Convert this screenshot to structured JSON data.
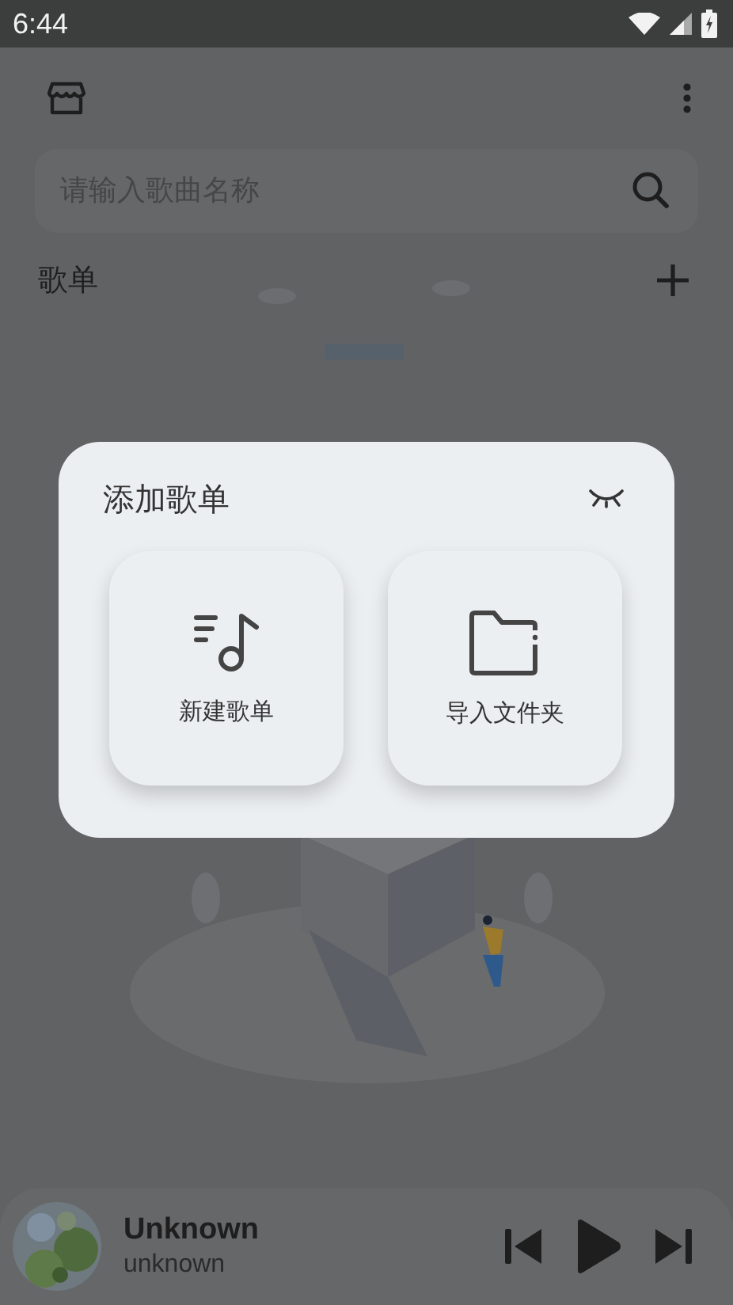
{
  "status_bar": {
    "time": "6:44"
  },
  "search": {
    "placeholder": "请输入歌曲名称"
  },
  "sections": [
    {
      "title": "歌单",
      "kind": "add"
    }
  ],
  "dialog": {
    "title": "添加歌单",
    "options": [
      {
        "kind": "new",
        "label": "新建歌单"
      },
      {
        "kind": "folder",
        "label": "导入文件夹"
      }
    ]
  },
  "player": {
    "title": "Unknown",
    "artist": "unknown",
    "playing": false
  }
}
